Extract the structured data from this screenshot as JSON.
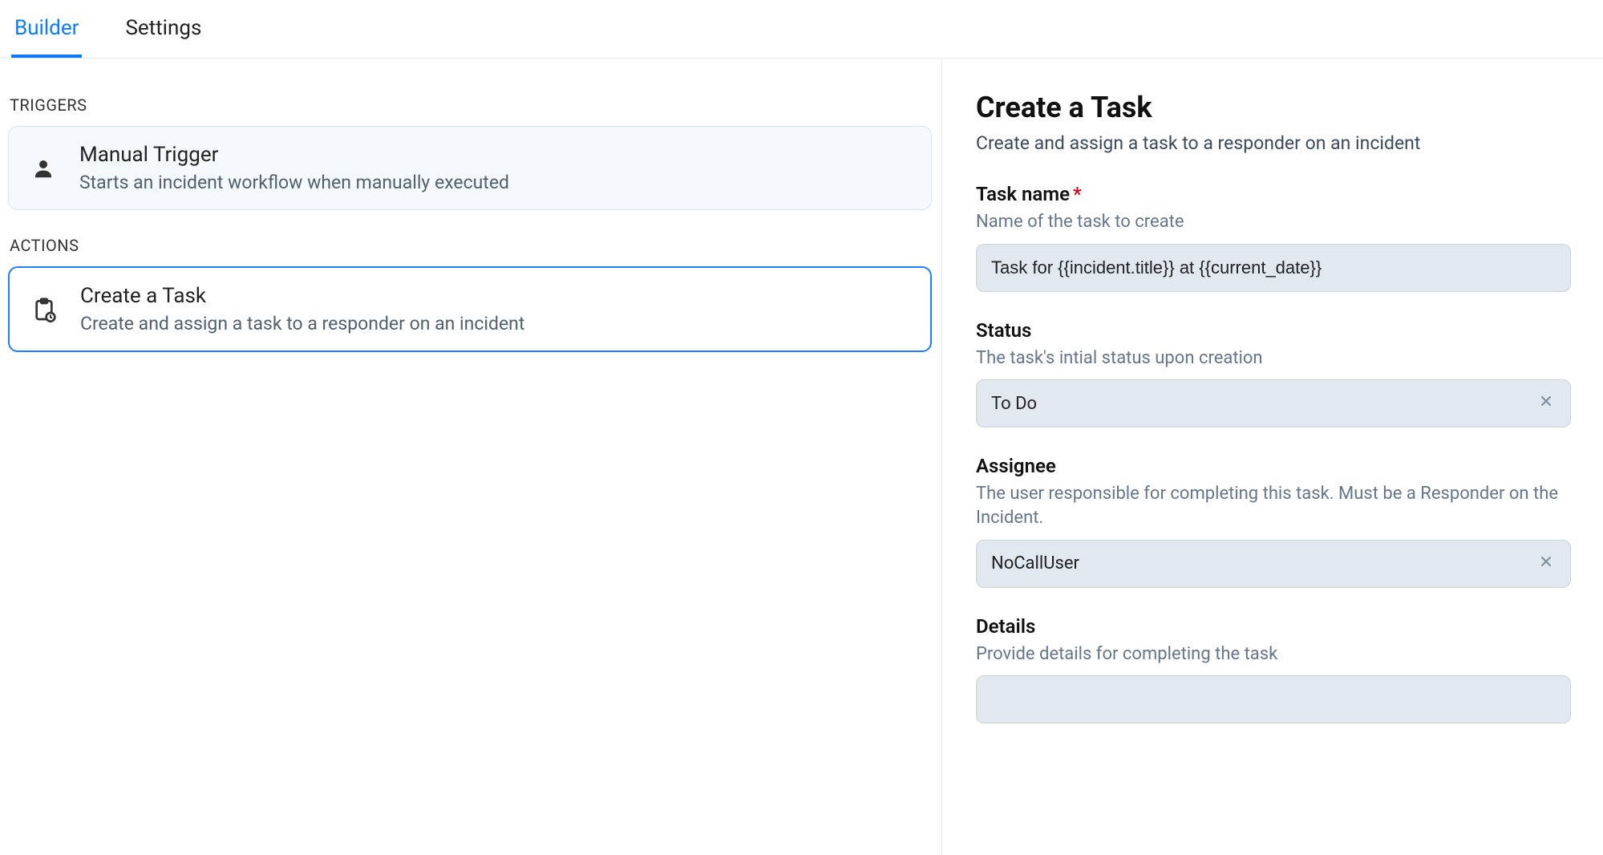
{
  "tabs": {
    "builder": "Builder",
    "settings": "Settings"
  },
  "left": {
    "triggers_label": "TRIGGERS",
    "actions_label": "ACTIONS",
    "trigger": {
      "title": "Manual Trigger",
      "sub": "Starts an incident workflow when manually executed"
    },
    "action": {
      "title": "Create a Task",
      "sub": "Create and assign a task to a responder on an incident"
    }
  },
  "panel": {
    "title": "Create a Task",
    "sub": "Create and assign a task to a responder on an incident",
    "task_name": {
      "label": "Task name",
      "help": "Name of the task to create",
      "value": "Task for {{incident.title}} at {{current_date}}"
    },
    "status": {
      "label": "Status",
      "help": "The task's intial status upon creation",
      "value": "To Do"
    },
    "assignee": {
      "label": "Assignee",
      "help": "The user responsible for completing this task. Must be a Responder on the Incident.",
      "value": "NoCallUser"
    },
    "details": {
      "label": "Details",
      "help": "Provide details for completing the task",
      "value": ""
    }
  }
}
